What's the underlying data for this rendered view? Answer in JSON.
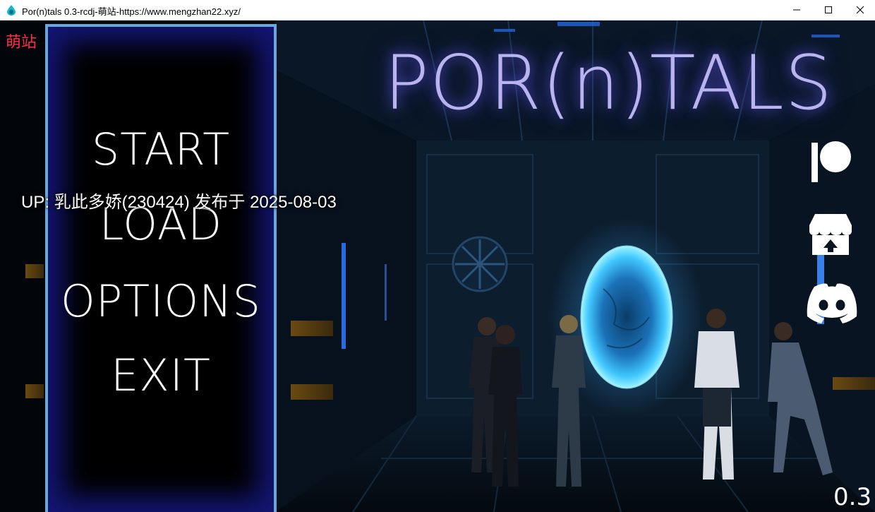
{
  "window": {
    "title": "Por(n)tals 0.3-rcdj-萌站-https://www.mengzhan22.xyz/",
    "icon": "teardrop-app-icon"
  },
  "game": {
    "corner_logo": "萌站",
    "title": "POR(n)TALS",
    "menu": {
      "start": "START",
      "load": "LOAD",
      "options": "OPTIONS",
      "exit": "EXIT"
    },
    "upload_notice": "UP: 乳此多娇(230424) 发布于 2025-08-03",
    "social_links": [
      "patreon-icon",
      "itch-io-icon",
      "discord-icon"
    ],
    "version": "0.3"
  },
  "colors": {
    "panel_border": "#6aa6d8",
    "panel_glow": "#14167a",
    "title_text": "#b9b3f0",
    "title_glow": "#6e5fff",
    "portal": "#2aa0ff",
    "corner_logo": "#ff2d4a"
  }
}
